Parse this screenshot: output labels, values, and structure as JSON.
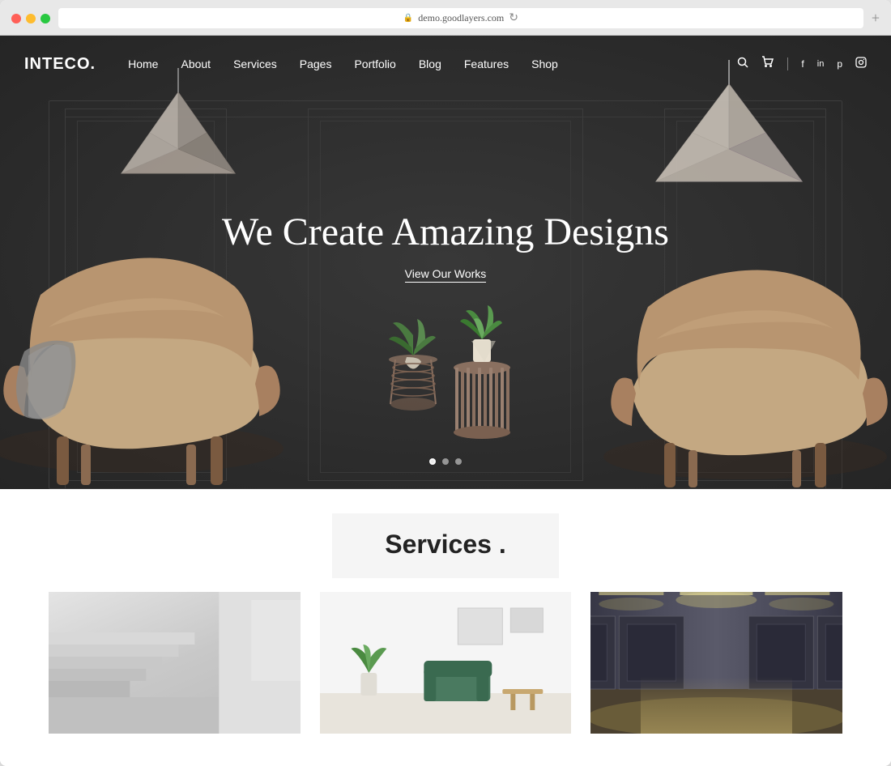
{
  "browser": {
    "address": "demo.goodlayers.com",
    "new_tab_label": "+"
  },
  "site": {
    "logo": "INTECO.",
    "tagline": "We Create Amazing Designs",
    "cta_label": "View Our Works"
  },
  "nav": {
    "links": [
      {
        "label": "Home"
      },
      {
        "label": "About"
      },
      {
        "label": "Services"
      },
      {
        "label": "Pages"
      },
      {
        "label": "Portfolio"
      },
      {
        "label": "Blog"
      },
      {
        "label": "Features"
      },
      {
        "label": "Shop"
      }
    ],
    "social": [
      "f",
      "in",
      "p",
      "ig"
    ]
  },
  "services": {
    "title": "Services .",
    "cards": [
      {
        "alt": "Staircase interior"
      },
      {
        "alt": "Living room interior"
      },
      {
        "alt": "Corridor interior"
      }
    ]
  }
}
